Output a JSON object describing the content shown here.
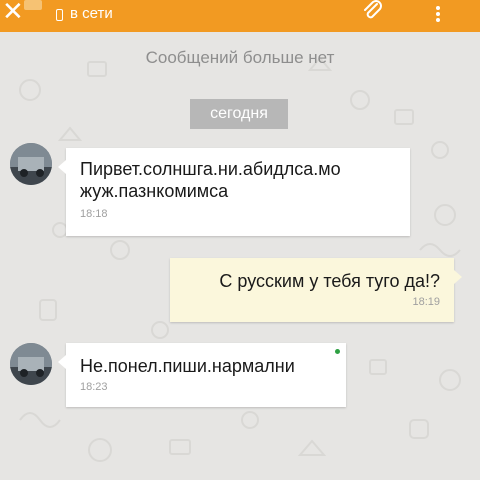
{
  "header": {
    "status": "в сети",
    "close_icon": "close-icon",
    "attach_icon": "paperclip-icon",
    "menu_icon": "more-vert-icon",
    "bar_color": "#f29a22"
  },
  "chat": {
    "no_more": "Сообщений больше нет",
    "date_label": "сегодня",
    "messages": [
      {
        "direction": "incoming",
        "lines": [
          "Пирвет.солншга.ни.абидлса.мо",
          "жуж.пазнкомимса"
        ],
        "time": "18:18"
      },
      {
        "direction": "outgoing",
        "lines": [
          "С русским у тебя туго да!?"
        ],
        "time": "18:19"
      },
      {
        "direction": "incoming",
        "lines": [
          "Не.понел.пиши.нармални"
        ],
        "time": "18:23"
      }
    ]
  },
  "colors": {
    "background": "#e6e5e3",
    "incoming_bubble": "#ffffff",
    "outgoing_bubble": "#fbf7dc",
    "date_chip": "#b7b7b7",
    "online": "#2ea043"
  }
}
